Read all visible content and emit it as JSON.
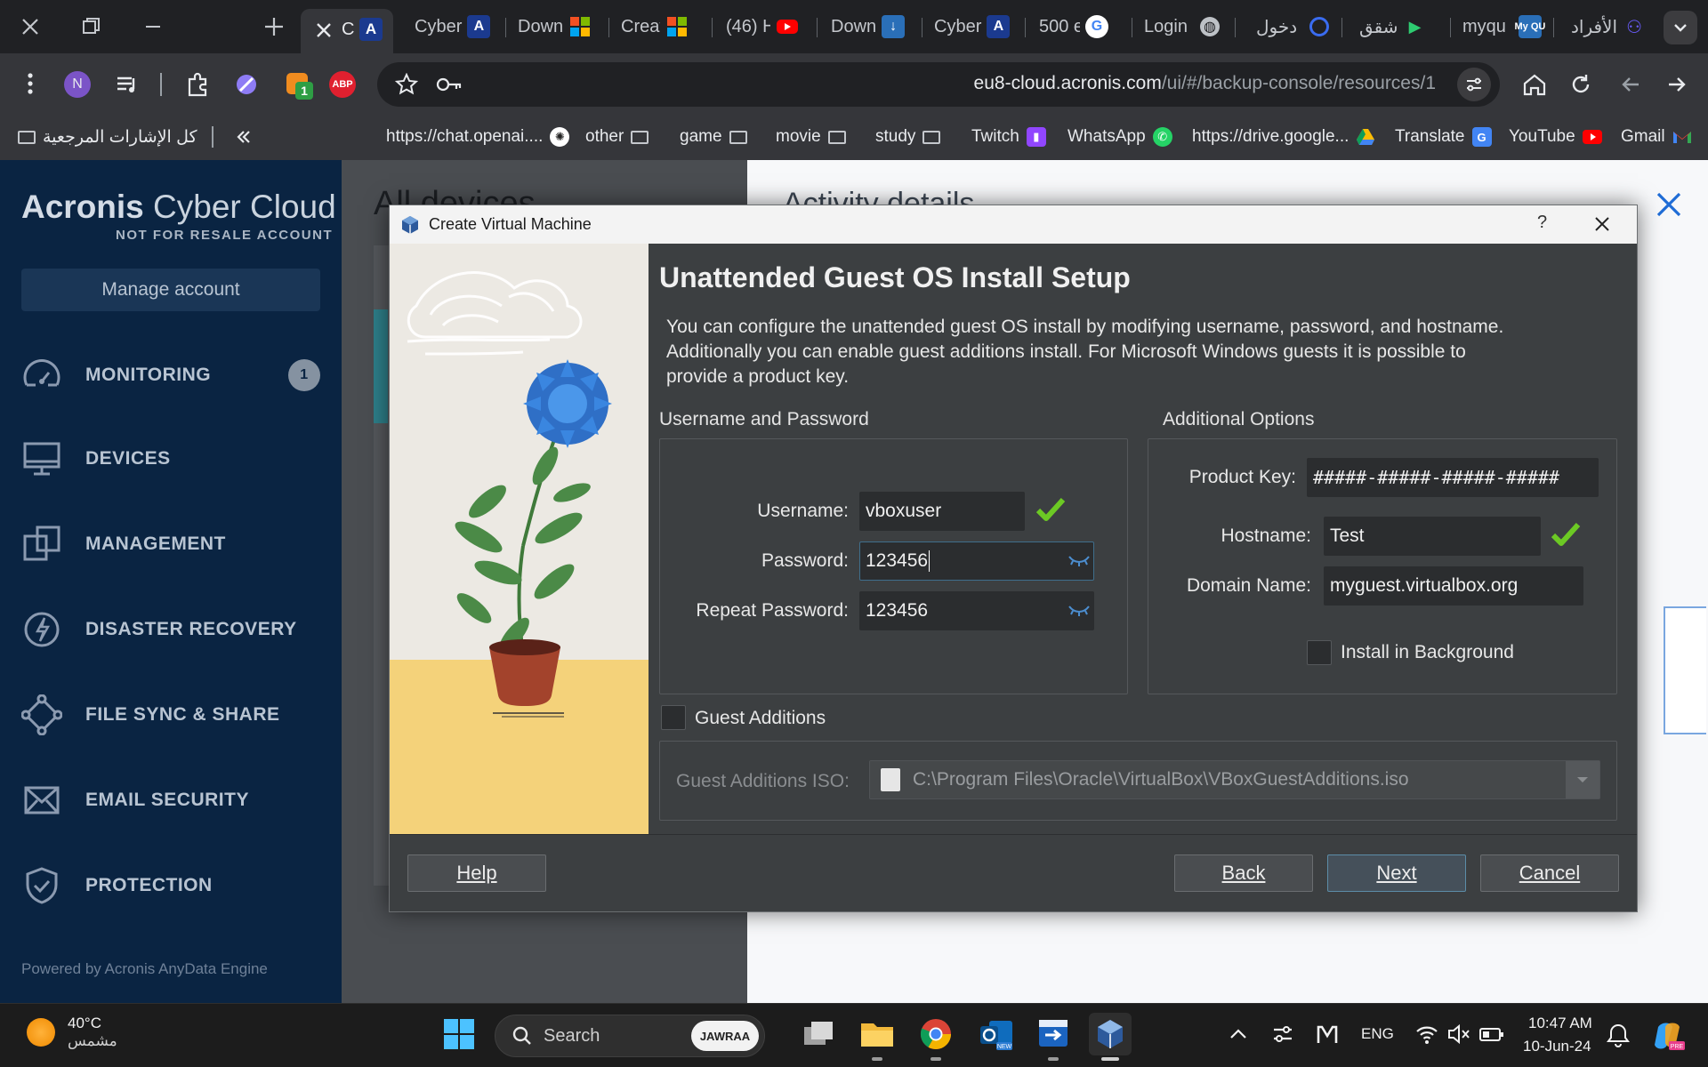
{
  "browser": {
    "tabs": [
      {
        "label": "C",
        "icon": "acronis-icon",
        "active": true
      },
      {
        "label": "Cyber",
        "icon": "acronis-icon"
      },
      {
        "label": "Down",
        "icon": "microsoft-icon"
      },
      {
        "label": "Create",
        "icon": "microsoft-icon"
      },
      {
        "label": "(46) H",
        "icon": "youtube-icon"
      },
      {
        "label": "Down",
        "icon": "virtualbox-download-icon"
      },
      {
        "label": "Cyber",
        "icon": "acronis-icon"
      },
      {
        "label": "500 e",
        "icon": "google-icon"
      },
      {
        "label": "Login",
        "icon": "globe-icon"
      },
      {
        "label": "دخول",
        "icon": "circle-icon"
      },
      {
        "label": "شقق",
        "icon": "play-icon"
      },
      {
        "label": "myqu",
        "icon": "myqu-icon"
      },
      {
        "label": "الأفراد",
        "icon": "people-icon"
      }
    ],
    "url_host": "eu8-cloud.acronis.com",
    "url_path": "/ui/#/backup-console/resources/1",
    "extension_badge": "1",
    "abp_label": "ABP",
    "profile_initial": "N",
    "bookmarks": [
      {
        "label": "https://chat.openai....",
        "icon": "openai-icon"
      },
      {
        "label": "other",
        "icon": "folder-icon"
      },
      {
        "label": "game",
        "icon": "folder-icon"
      },
      {
        "label": "movie",
        "icon": "folder-icon"
      },
      {
        "label": "study",
        "icon": "folder-icon"
      },
      {
        "label": "Twitch",
        "icon": "twitch-icon"
      },
      {
        "label": "WhatsApp",
        "icon": "whatsapp-icon"
      },
      {
        "label": "https://drive.google...",
        "icon": "drive-icon"
      },
      {
        "label": "Translate",
        "icon": "translate-icon"
      },
      {
        "label": "YouTube",
        "icon": "youtube-icon"
      },
      {
        "label": "Gmail",
        "icon": "gmail-icon"
      }
    ],
    "all_bookmarks_label": "كل الإشارات المرجعية"
  },
  "sidebar": {
    "logo_main": "Acronis",
    "logo_sub": "Cyber Cloud",
    "account_type": "NOT FOR RESALE ACCOUNT",
    "manage_account": "Manage account",
    "items": [
      {
        "label": "MONITORING",
        "icon": "gauge-icon",
        "badge": "1"
      },
      {
        "label": "DEVICES",
        "icon": "monitor-icon"
      },
      {
        "label": "MANAGEMENT",
        "icon": "management-icon"
      },
      {
        "label": "DISASTER RECOVERY",
        "icon": "lightning-icon"
      },
      {
        "label": "FILE SYNC & SHARE",
        "icon": "share-icon"
      },
      {
        "label": "EMAIL SECURITY",
        "icon": "envelope-icon"
      },
      {
        "label": "PROTECTION",
        "icon": "shield-icon"
      }
    ],
    "powered_by": "Powered by Acronis AnyData Engine"
  },
  "background": {
    "title": "All devices",
    "panel_title": "Activity details"
  },
  "dialog": {
    "window_title": "Create Virtual Machine",
    "help_glyph": "?",
    "page_title": "Unattended Guest OS Install Setup",
    "description": "You can configure the unattended guest OS install by modifying username, password, and hostname. Additionally you can enable guest additions install. For Microsoft Windows guests it is possible to provide a product key.",
    "username_password_group": "Username and Password",
    "additional_options_group": "Additional Options",
    "username_label": "Username:",
    "username_value": "vboxuser",
    "password_label": "Password:",
    "password_value": "123456",
    "repeat_password_label": "Repeat Password:",
    "repeat_password_value": "123456",
    "product_key_label": "Product Key:",
    "product_key_value": "#####-#####-#####-#####",
    "hostname_label": "Hostname:",
    "hostname_value": "Test",
    "domain_label": "Domain Name:",
    "domain_value": "myguest.virtualbox.org",
    "install_background_label": "Install in Background",
    "install_background_checked": false,
    "guest_additions_label": "Guest Additions",
    "guest_additions_checked": false,
    "iso_label": "Guest Additions ISO:",
    "iso_value": "C:\\Program Files\\Oracle\\VirtualBox\\VBoxGuestAdditions.iso",
    "buttons": {
      "help": "Help",
      "back": "Back",
      "next": "Next",
      "cancel": "Cancel"
    }
  },
  "taskbar": {
    "weather_temp": "40°C",
    "weather_desc": "مشمس",
    "search_placeholder": "Search",
    "search_badge": "JAWRAA",
    "language": "ENG",
    "time": "10:47 AM",
    "date": "10-Jun-24",
    "apps": [
      "windows-start-icon",
      "task-view-icon",
      "file-explorer-icon",
      "chrome-icon",
      "outlook-new-icon",
      "remote-app-icon",
      "virtualbox-icon"
    ]
  },
  "colors": {
    "sidebar_bg": "#0a2442",
    "dialog_bg": "#3c3f41",
    "valid_check": "#6cc924",
    "accent_blue": "#1a73e8"
  }
}
